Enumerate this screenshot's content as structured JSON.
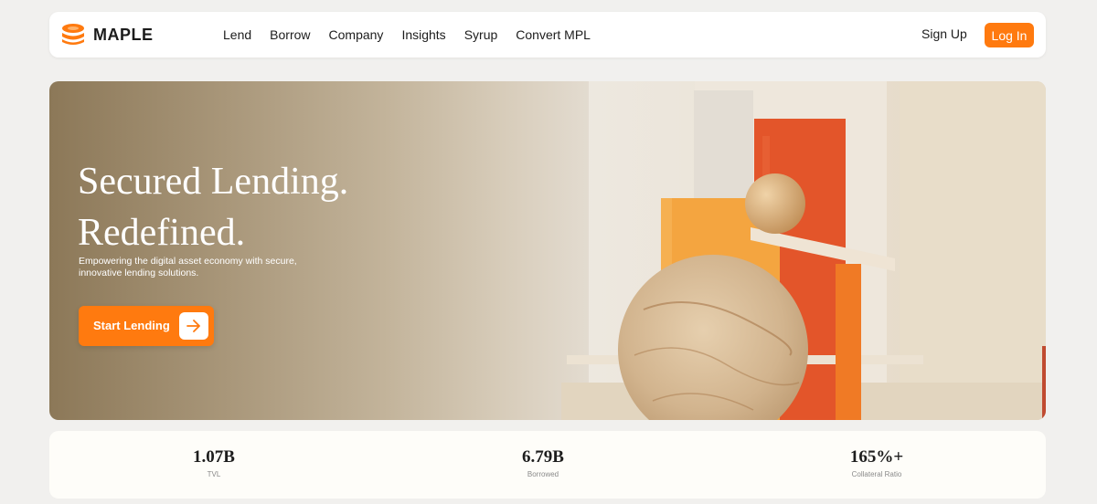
{
  "brand": {
    "name": "MAPLE",
    "accent": "#ff7a0f",
    "logo_icon": "stacked-coins-icon"
  },
  "nav": {
    "links": [
      "Lend",
      "Borrow",
      "Company",
      "Insights",
      "Syrup",
      "Convert MPL"
    ],
    "signup_label": "Sign Up",
    "login_label": "Log In"
  },
  "hero": {
    "title_line1": "Secured Lending.",
    "title_line2": "Redefined.",
    "subtitle_line1": "Empowering the digital asset economy with secure,",
    "subtitle_line2": "innovative lending solutions.",
    "cta_label": "Start Lending",
    "cta_icon": "arrow-right-icon"
  },
  "stats": [
    {
      "value": "1.07B",
      "label": "TVL"
    },
    {
      "value": "6.79B",
      "label": "Borrowed"
    },
    {
      "value": "165%+",
      "label": "Collateral Ratio"
    }
  ]
}
